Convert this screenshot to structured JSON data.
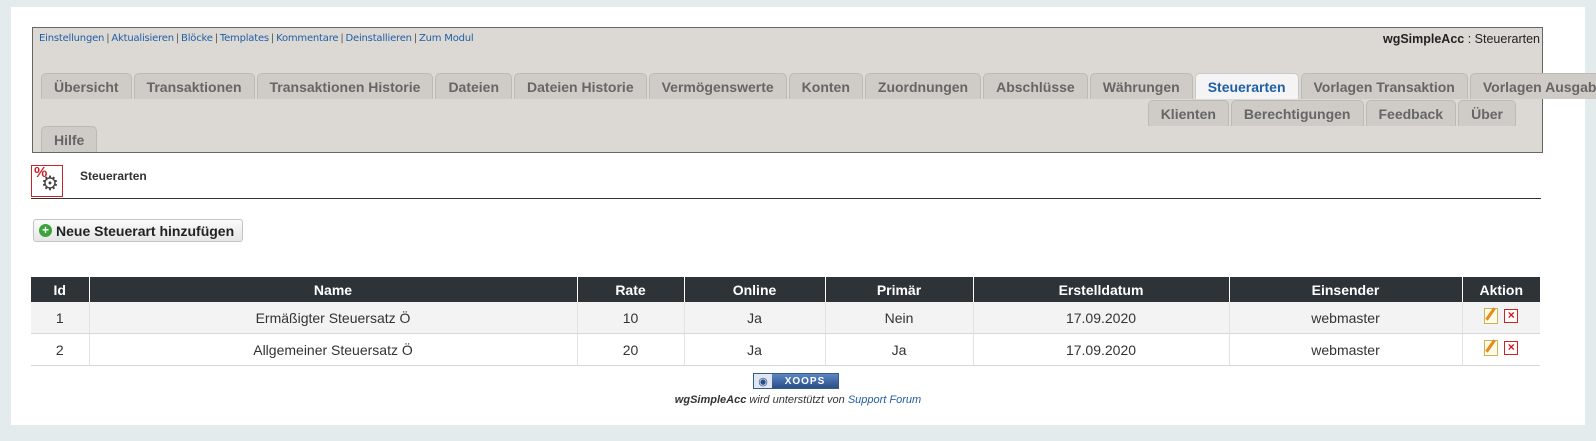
{
  "quicklinks": [
    "Einstellungen",
    "Aktualisieren",
    "Blöcke",
    "Templates",
    "Kommentare",
    "Deinstallieren",
    "Zum Modul"
  ],
  "module": {
    "name": "wgSimpleAcc",
    "separator": " : ",
    "page": "Steuerarten"
  },
  "tabs_row1": [
    "Übersicht",
    "Transaktionen",
    "Transaktionen Historie",
    "Dateien",
    "Dateien Historie",
    "Vermögenswerte",
    "Konten",
    "Zuordnungen",
    "Abschlüsse",
    "Währungen",
    "Steuerarten",
    "Vorlagen Transaktion",
    "Vorlagen Ausgabe"
  ],
  "tabs_row2": [
    "Klienten",
    "Berechtigungen",
    "Feedback",
    "Über"
  ],
  "tabs_row3": [
    "Hilfe"
  ],
  "active_tab": "Steuerarten",
  "page_header": {
    "title": "Steuerarten",
    "icon": "tax-gear-icon"
  },
  "add_button": {
    "label": "Neue Steuerart hinzufügen",
    "icon": "plus-circle-icon"
  },
  "table": {
    "headers": [
      "Id",
      "Name",
      "Rate",
      "Online",
      "Primär",
      "Erstelldatum",
      "Einsender",
      "Aktion"
    ],
    "rows": [
      [
        "1",
        "Ermäßigter Steuersatz Ö",
        "10",
        "Ja",
        "Nein",
        "17.09.2020",
        "webmaster"
      ],
      [
        "2",
        "Allgemeiner Steuersatz Ö",
        "20",
        "Ja",
        "Ja",
        "17.09.2020",
        "webmaster"
      ]
    ]
  },
  "footer": {
    "badge": "XOOPS",
    "module": "wgSimpleAcc",
    "text": " wird unterstützt von ",
    "link": "Support Forum"
  },
  "colors": {
    "accent": "#1f5fa8",
    "header_bg": "#2e3338",
    "nav_bg": "#dcd9d4"
  }
}
